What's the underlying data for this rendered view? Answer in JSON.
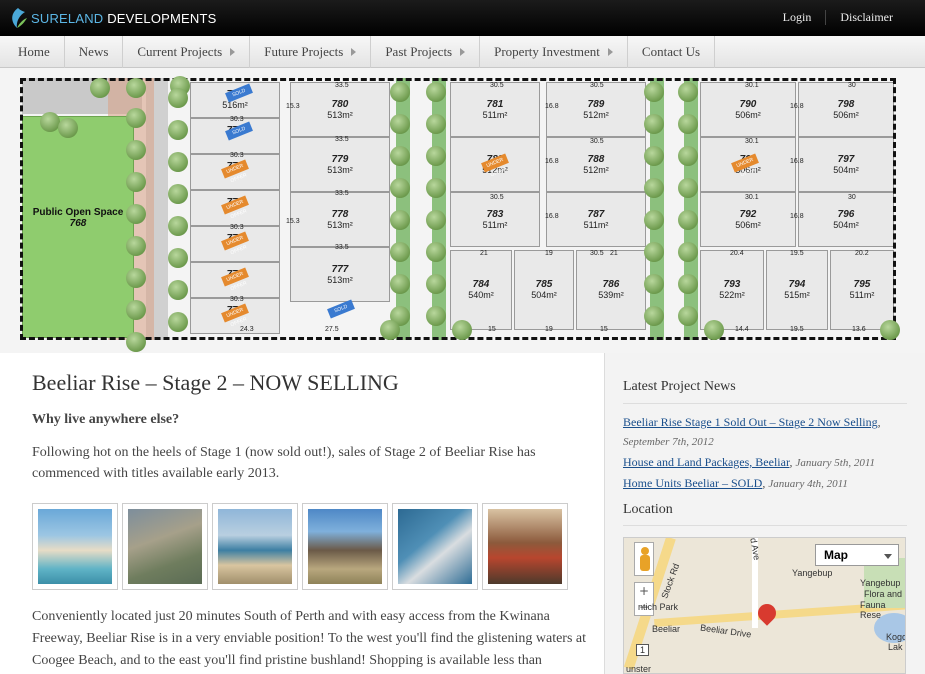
{
  "brand": {
    "name_part1": "SURELAND",
    "name_part2": " DEVELOPMENTS"
  },
  "top_links": [
    "Login",
    "Disclaimer"
  ],
  "nav": [
    {
      "label": "Home",
      "arrow": false
    },
    {
      "label": "News",
      "arrow": false
    },
    {
      "label": "Current Projects",
      "arrow": true
    },
    {
      "label": "Future Projects",
      "arrow": true
    },
    {
      "label": "Past Projects",
      "arrow": true
    },
    {
      "label": "Property Investment",
      "arrow": true
    },
    {
      "label": "Contact Us",
      "arrow": false
    }
  ],
  "site_plan": {
    "public_open_space": "Public Open Space",
    "pos_number": "768",
    "lots": [
      {
        "num": "780",
        "area": "513m²"
      },
      {
        "num": "779",
        "area": "513m²"
      },
      {
        "num": "778",
        "area": "513m²"
      },
      {
        "num": "777",
        "area": "513m²"
      },
      {
        "num": "781",
        "area": "511m²"
      },
      {
        "num": "782",
        "area": "512m²"
      },
      {
        "num": "783",
        "area": "511m²"
      },
      {
        "num": "784",
        "area": "540m²"
      },
      {
        "num": "785",
        "area": "504m²"
      },
      {
        "num": "786",
        "area": "539m²"
      },
      {
        "num": "789",
        "area": "512m²"
      },
      {
        "num": "788",
        "area": "512m²"
      },
      {
        "num": "787",
        "area": "511m²"
      },
      {
        "num": "790",
        "area": "506m²"
      },
      {
        "num": "791",
        "area": "506m²"
      },
      {
        "num": "792",
        "area": "506m²"
      },
      {
        "num": "793",
        "area": "522m²"
      },
      {
        "num": "794",
        "area": "515m²"
      },
      {
        "num": "798",
        "area": "506m²"
      },
      {
        "num": "797",
        "area": "504m²"
      },
      {
        "num": "796",
        "area": "504m²"
      },
      {
        "num": "795",
        "area": "511m²"
      }
    ],
    "left_lots": [
      {
        "num": "776",
        "area": "516m²"
      },
      {
        "num": "775",
        "area": ""
      },
      {
        "num": "774",
        "area": ""
      },
      {
        "num": "773",
        "area": ""
      },
      {
        "num": "772",
        "area": ""
      },
      {
        "num": "771",
        "area": ""
      },
      {
        "num": "770",
        "area": ""
      }
    ],
    "dims": {
      "d1": "33.5",
      "d2": "30.3",
      "d3": "30.5",
      "d4": "30.1",
      "d5": "30",
      "d6": "24.3",
      "d7": "27.5",
      "d8": "14.4",
      "d9": "19.5",
      "d10": "13.6",
      "d11": "15",
      "d12": "19",
      "d13": "21",
      "d14": "20.4",
      "d15": "20.2",
      "d16": "16.8",
      "d17": "15.3"
    },
    "tag_labels": {
      "sold": "SOLD",
      "under_offer": "UNDER OFFER"
    }
  },
  "main": {
    "title": "Beeliar Rise – Stage 2 – NOW SELLING",
    "lead": "Why live anywhere else?",
    "para1": "Following hot on the heels of Stage 1 (now sold out!), sales of Stage 2 of Beeliar Rise has commenced with titles available early 2013.",
    "para2": "Conveniently located just 20 minutes South of Perth and with easy access from the Kwinana Freeway, Beeliar Rise is in a very enviable position! To the west you'll find the glistening waters at Coogee Beach, and to the east you'll find pristine bushland! Shopping is available less than"
  },
  "sidebar": {
    "news_heading": "Latest Project News",
    "news": [
      {
        "title": "Beeliar Rise Stage 1 Sold Out – Stage 2 Now Selling",
        "date": "September 7th, 2012"
      },
      {
        "title": "House and Land Packages, Beeliar",
        "date": "January 5th, 2011"
      },
      {
        "title": "Home Units Beeliar – SOLD",
        "date": "January 4th, 2011"
      }
    ],
    "location_heading": "Location",
    "map": {
      "type_label": "Map",
      "labels": {
        "yangebup": "Yangebup",
        "yangebup2": "Yangebup",
        "flora": "Flora and",
        "fauna": "Fauna Rese",
        "park": "ntich Park",
        "beeliar": "Beeliar",
        "beeliar_drive": "Beeliar Drive",
        "stock_rd": "Stock Rd",
        "ave": "d Ave",
        "kogo": "Kogo",
        "lak": "Lak",
        "munster": "unster",
        "route": "1"
      }
    }
  }
}
